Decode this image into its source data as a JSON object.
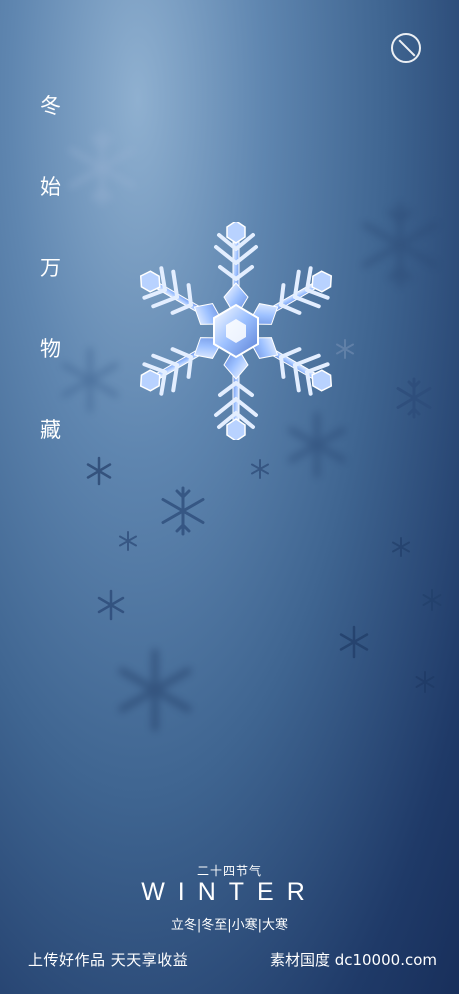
{
  "vertical_text": [
    "冬",
    "始",
    "万",
    "物",
    "藏"
  ],
  "solar_term_label": "二十四节气",
  "season_title": "WINTER",
  "solar_terms": "立冬|冬至|小寒|大寒",
  "footer": {
    "left": "上传好作品  天天享收益",
    "right": "素材国度  dc10000.com"
  },
  "colors": {
    "background_top": "#8fb0d0",
    "background_bottom": "#182f5b",
    "text": "#ffffff",
    "crystal": "#d8e8ff"
  },
  "icons": [
    "circle-slash-icon",
    "snowflake-icon"
  ]
}
